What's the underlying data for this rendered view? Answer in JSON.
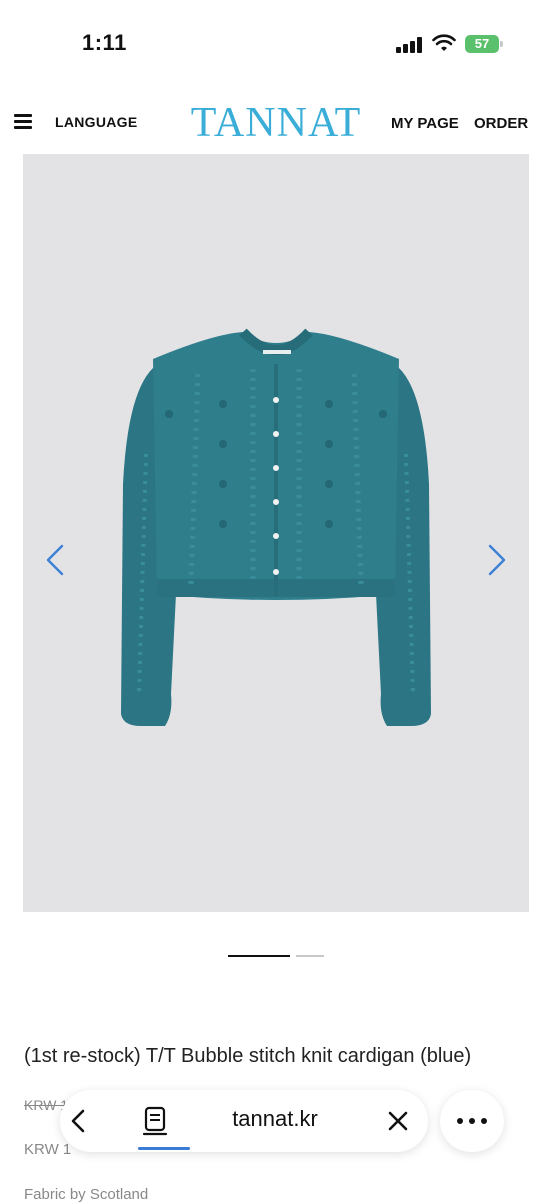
{
  "status_bar": {
    "time": "1:11",
    "battery": "57"
  },
  "header": {
    "language_label": "LANGUAGE",
    "logo_text": "TANNAT",
    "mypage_label": "MY PAGE",
    "order_label": "ORDER",
    "logo_color": "#3aaed8"
  },
  "product": {
    "title": "(1st re-stock) T/T Bubble stitch knit cardigan (blue)",
    "price_original": "KRW 1",
    "price_sale": "KRW 1",
    "fabric": "Fabric by Scotland",
    "image_alt": "blue knit cardigan"
  },
  "gallery": {
    "pages": 2,
    "current_page": 1
  },
  "browser": {
    "url": "tannat.kr"
  },
  "colors": {
    "cardigan": "#2f7e8c",
    "accent_blue": "#3a7bd5",
    "battery_green": "#5ac06b"
  }
}
